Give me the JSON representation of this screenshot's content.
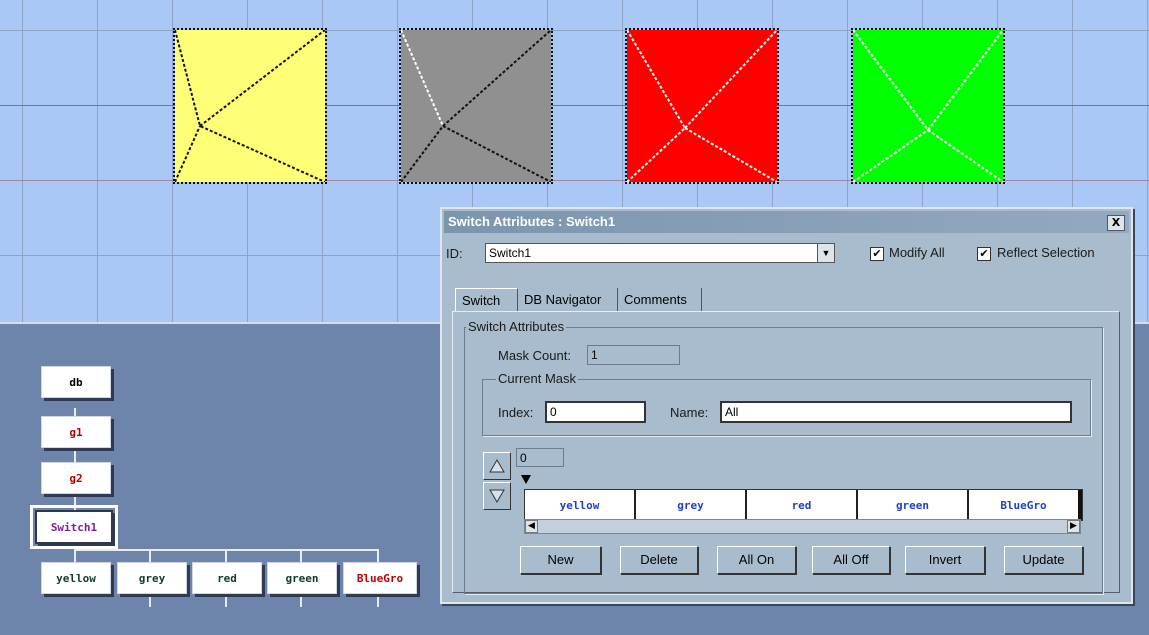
{
  "viewport": {
    "shapes": [
      {
        "name": "yellow",
        "color": "#ffff77"
      },
      {
        "name": "grey",
        "color": "#909090"
      },
      {
        "name": "red",
        "color": "#ff0000"
      },
      {
        "name": "green",
        "color": "#00ff00"
      }
    ]
  },
  "tree": {
    "db": "db",
    "g1": "g1",
    "g2": "g2",
    "switch": "Switch1",
    "children": [
      "yellow",
      "grey",
      "red",
      "green",
      "BlueGro"
    ]
  },
  "colors": {
    "node_db": "#000000",
    "node_group": "#b00000",
    "node_switch": "#7a1fa0",
    "node_child": "#0f3d2a",
    "node_bluegro": "#c00000"
  },
  "dialog": {
    "title": "Switch Attributes : Switch1",
    "close_label": "X",
    "id_label": "ID:",
    "id_value": "Switch1",
    "modify_all_label": "Modify All",
    "modify_all_checked": true,
    "reflect_selection_label": "Reflect Selection",
    "reflect_selection_checked": true,
    "tabs": [
      {
        "label": "Switch"
      },
      {
        "label": "DB Navigator"
      },
      {
        "label": "Comments"
      }
    ],
    "switch_attributes_title": "Switch Attributes",
    "mask_count_label": "Mask Count:",
    "mask_count_value": "1",
    "current_mask_title": "Current Mask",
    "index_label": "Index:",
    "index_value": "0",
    "name_label": "Name:",
    "name_value": "All",
    "offset_value": "0",
    "mask_cells": [
      "yellow",
      "grey",
      "red",
      "green",
      "BlueGro"
    ],
    "buttons": {
      "new": "New",
      "delete": "Delete",
      "all_on": "All On",
      "all_off": "All Off",
      "invert": "Invert",
      "update": "Update"
    }
  }
}
